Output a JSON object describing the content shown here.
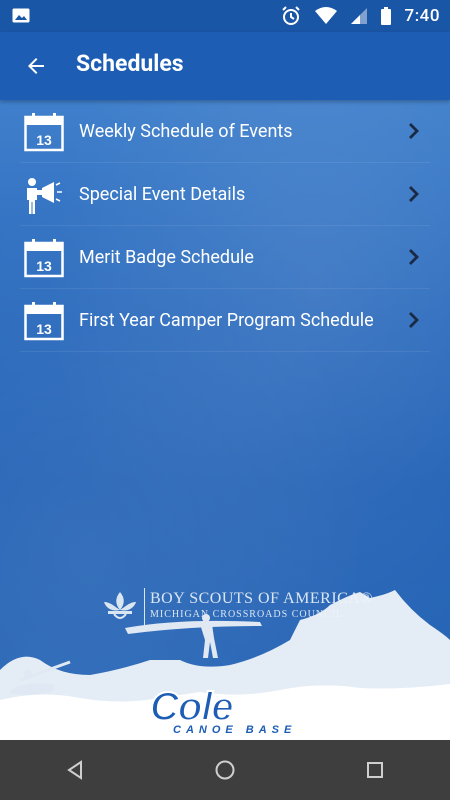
{
  "status_bar": {
    "time": "7:40",
    "icons": [
      "image-icon",
      "alarm-icon",
      "wifi-icon",
      "signal-icon",
      "battery-icon"
    ]
  },
  "app_bar": {
    "title": "Schedules",
    "back_icon": "arrow-left-icon"
  },
  "schedule_items": [
    {
      "label": "Weekly Schedule of Events",
      "icon": "calendar-icon",
      "calendar_day": "13"
    },
    {
      "label": "Special Event Details",
      "icon": "megaphone-person-icon"
    },
    {
      "label": "Merit Badge Schedule",
      "icon": "calendar-icon",
      "calendar_day": "13"
    },
    {
      "label": "First Year Camper Program Schedule",
      "icon": "calendar-icon",
      "calendar_day": "13"
    }
  ],
  "branding": {
    "org_name": "BOY SCOUTS OF AMERICA®",
    "council": "MICHIGAN CROSSROADS COUNCIL",
    "logo_text": "Cole",
    "logo_subtext": "CANOE BASE"
  },
  "nav_bar": {
    "icons": [
      "back-triangle-icon",
      "home-circle-icon",
      "recents-square-icon"
    ]
  },
  "colors": {
    "app_bar": "#1d5db4",
    "status_bar": "#1a56a6",
    "nav_bar": "#3e3e3e"
  }
}
